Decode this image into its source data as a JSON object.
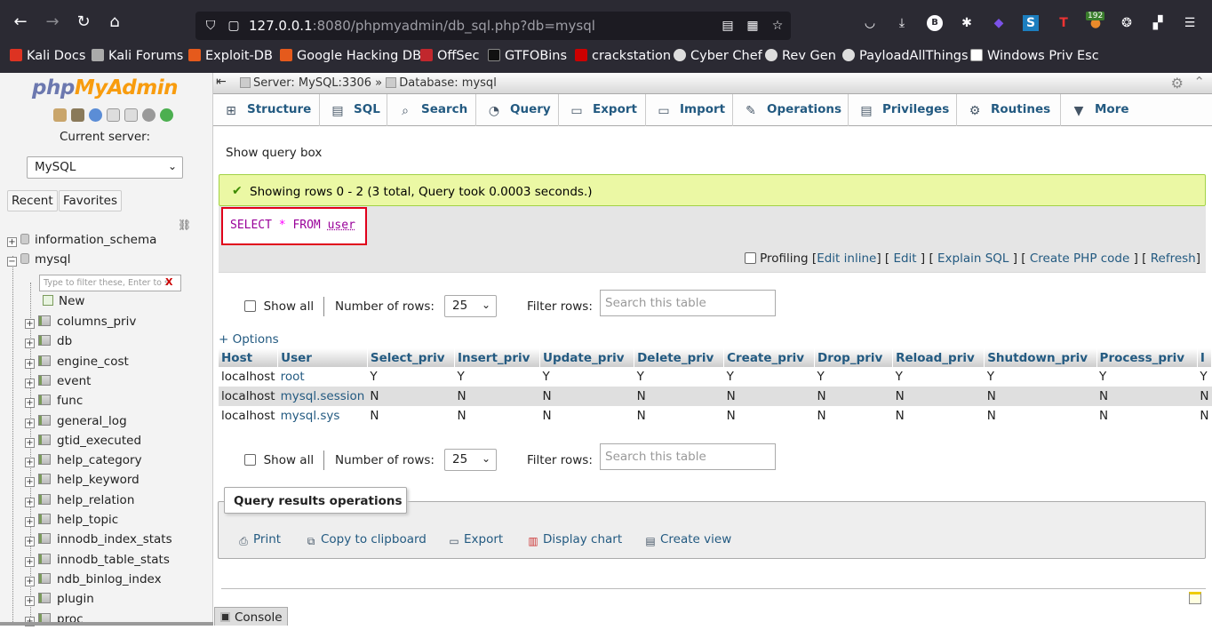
{
  "browser": {
    "url_host": "127.0.0.1",
    "url_rest": ":8080/phpmyadmin/db_sql.php?db=mysql",
    "ext_badge": "192",
    "bookmarks": [
      "Kali Docs",
      "Kali Forums",
      "Exploit-DB",
      "Google Hacking DB",
      "OffSec",
      "GTFOBins",
      "crackstation",
      "Cyber Chef",
      "Rev Gen",
      "PayloadAllThings",
      "Windows Priv Esc"
    ]
  },
  "sidebar": {
    "logo_php": "php",
    "logo_admin": "MyAdmin",
    "current_server_label": "Current server:",
    "server_value": "MySQL",
    "recent_tab": "Recent",
    "favorites_tab": "Favorites",
    "databases": [
      "information_schema",
      "mysql"
    ],
    "filter_placeholder": "Type to filter these, Enter to s",
    "new_label": "New",
    "tables": [
      "columns_priv",
      "db",
      "engine_cost",
      "event",
      "func",
      "general_log",
      "gtid_executed",
      "help_category",
      "help_keyword",
      "help_relation",
      "help_topic",
      "innodb_index_stats",
      "innodb_table_stats",
      "ndb_binlog_index",
      "plugin",
      "proc"
    ]
  },
  "breadcrumb": {
    "server": "Server: MySQL:3306",
    "separator": "»",
    "database": "Database: mysql"
  },
  "tabs": [
    "Structure",
    "SQL",
    "Search",
    "Query",
    "Export",
    "Import",
    "Operations",
    "Privileges",
    "Routines",
    "More"
  ],
  "show_query_box": "Show query box",
  "success_message": "Showing rows 0 - 2 (3 total, Query took 0.0003 seconds.)",
  "sql": {
    "select": "SELECT",
    "star": "*",
    "from": "FROM",
    "table": "user"
  },
  "profiling": {
    "label": "Profiling",
    "edit_inline": "Edit inline",
    "edit": "Edit",
    "explain": "Explain SQL",
    "create_php": "Create PHP code",
    "refresh": "Refresh"
  },
  "navigation": {
    "show_all": "Show all",
    "rows_label": "Number of rows:",
    "rows_value": "25",
    "filter_label": "Filter rows:",
    "filter_placeholder": "Search this table"
  },
  "options_link": "+ Options",
  "table": {
    "columns": [
      "Host",
      "User",
      "Select_priv",
      "Insert_priv",
      "Update_priv",
      "Delete_priv",
      "Create_priv",
      "Drop_priv",
      "Reload_priv",
      "Shutdown_priv",
      "Process_priv",
      "I"
    ],
    "rows": [
      [
        "localhost",
        "root",
        "Y",
        "Y",
        "Y",
        "Y",
        "Y",
        "Y",
        "Y",
        "Y",
        "Y",
        "Y"
      ],
      [
        "localhost",
        "mysql.session",
        "N",
        "N",
        "N",
        "N",
        "N",
        "N",
        "N",
        "N",
        "N",
        "N"
      ],
      [
        "localhost",
        "mysql.sys",
        "N",
        "N",
        "N",
        "N",
        "N",
        "N",
        "N",
        "N",
        "N",
        "N"
      ]
    ]
  },
  "query_ops": {
    "legend": "Query results operations",
    "print": "Print",
    "copy": "Copy to clipboard",
    "export": "Export",
    "chart": "Display chart",
    "view": "Create view"
  },
  "console_label": "Console"
}
